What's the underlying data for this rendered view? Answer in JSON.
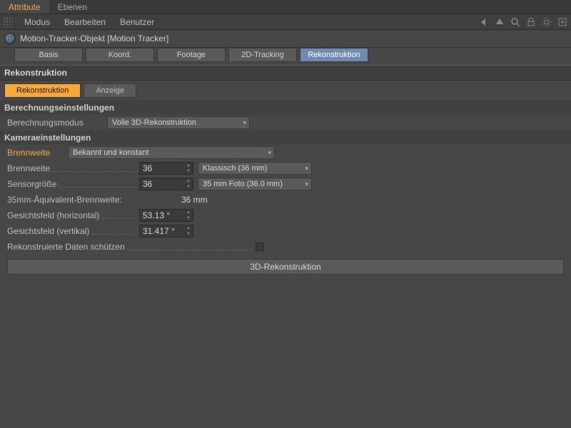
{
  "topTabs": {
    "attribute": "Attribute",
    "ebenen": "Ebenen"
  },
  "menu": {
    "modus": "Modus",
    "bearbeiten": "Bearbeiten",
    "benutzer": "Benutzer"
  },
  "objectHeader": "Motion-Tracker-Objekt [Motion Tracker]",
  "objTabs": {
    "basis": "Basis",
    "koord": "Koord.",
    "footage": "Footage",
    "tracking": "2D-Tracking",
    "rekon": "Rekonstruktion"
  },
  "sectionRekon": "Rekonstruktion",
  "subTabs": {
    "rekon": "Rekonstruktion",
    "anzeige": "Anzeige"
  },
  "calcSettings": {
    "header": "Berechnungseinstellungen",
    "modeLabel": "Berechnungsmodus",
    "modeValue": "Volle 3D-Rekonstruktion"
  },
  "camSettings": {
    "header": "Kameraeinstellungen",
    "focalKnown": {
      "label": "Brennweite",
      "value": "Bekannt und konstant"
    },
    "focal": {
      "label": "Brennweite",
      "value": "36",
      "preset": "Klassisch (36 mm)"
    },
    "sensor": {
      "label": "Sensorgröße",
      "value": "36",
      "preset": "35 mm Foto (36.0 mm)"
    },
    "equiv": {
      "label": "35mm-Äquivalent-Brennweite:",
      "value": "36 mm"
    },
    "fovH": {
      "label": "Gesichtsfeld (horizontal)",
      "value": "53.13 °"
    },
    "fovV": {
      "label": "Gesichtsfeld (vertikal)",
      "value": "31.417 °"
    },
    "protect": {
      "label": "Rekonstruierte Daten schützen"
    }
  },
  "bigButton": "3D-Rekonstruktion"
}
